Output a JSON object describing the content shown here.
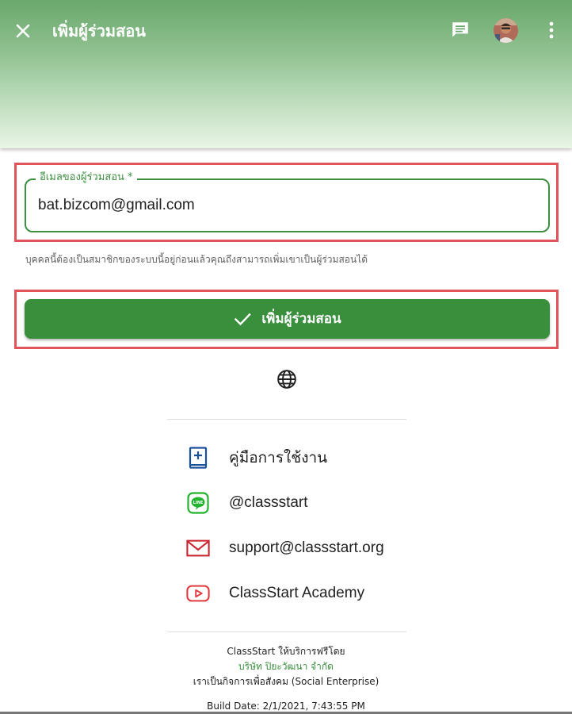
{
  "header": {
    "title": "เพิ่มผู้ร่วมสอน",
    "close_icon": "close-icon",
    "chat_icon": "chat-icon",
    "more_icon": "more-vert-icon",
    "gradient_top": "#6aa86c",
    "gradient_bottom": "#eaf5e8"
  },
  "form": {
    "email_label": "อีเมลของผู้ร่วมสอน *",
    "email_value": "bat.bizcom@gmail.com",
    "helper_text": "บุคคลนี้ต้องเป็นสมาชิกของระบบนี้อยู่ก่อนแล้วคุณถึงสามารถเพิ่มเขาเป็นผู้ร่วมสอนได้",
    "submit_label": "เพิ่มผู้ร่วมสอน",
    "accent_color": "#3a8f3d",
    "highlight_color": "#e15459"
  },
  "links": [
    {
      "label": "คู่มือการใช้งาน",
      "icon": "manual-book-icon"
    },
    {
      "label": "@classstart",
      "icon": "line-icon"
    },
    {
      "label": "support@classstart.org",
      "icon": "mail-icon"
    },
    {
      "label": "ClassStart Academy",
      "icon": "youtube-icon"
    }
  ],
  "footer": {
    "line1": "ClassStart ให้บริการฟรีโดย",
    "line2": "บริษัท ปิยะวัฒนา จำกัด",
    "line3": "เราเป็นกิจการเพื่อสังคม (Social Enterprise)",
    "build": "Build Date: 2/1/2021, 7:43:55 PM"
  }
}
